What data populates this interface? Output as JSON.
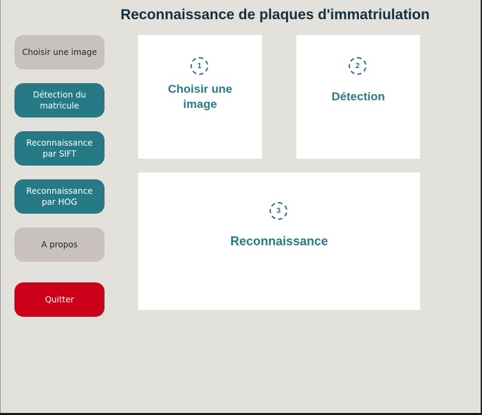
{
  "app": {
    "title": "Reconnaissance de plaques d'immatriulation"
  },
  "sidebar": {
    "buttons": [
      {
        "label": "Choisir une image"
      },
      {
        "label": "Détection du matricule"
      },
      {
        "label": "Reconnaissance par SIFT"
      },
      {
        "label": "Reconnaissance par HOG"
      },
      {
        "label": "A propos"
      },
      {
        "label": "Quitter"
      }
    ]
  },
  "steps": [
    {
      "number": "1",
      "label": "Choisir une image"
    },
    {
      "number": "2",
      "label": "Détection"
    },
    {
      "number": "3",
      "label": "Reconnaissance"
    }
  ],
  "colors": {
    "background": "#e3e1dc",
    "button_gray": "#c8c1bd",
    "button_teal": "#287986",
    "button_red": "#cc0018",
    "accent": "#2a7a86",
    "title": "#15303d"
  }
}
